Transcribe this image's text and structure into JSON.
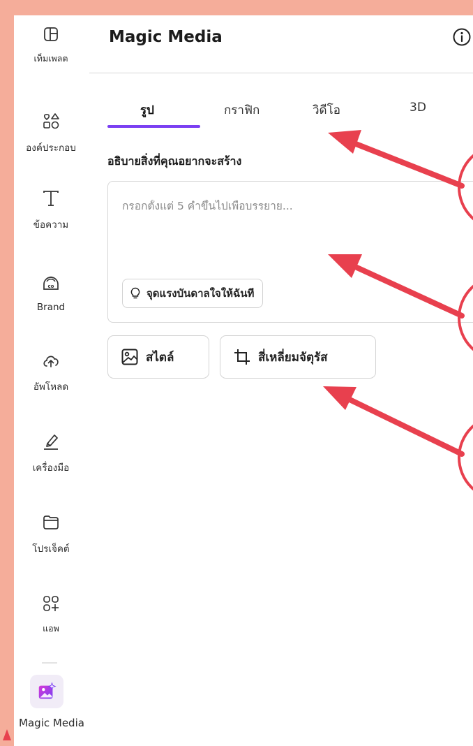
{
  "sidebar": {
    "items": [
      {
        "label": "เท็มเพลต",
        "icon": "template-icon"
      },
      {
        "label": "องค์ประกอบ",
        "icon": "elements-icon"
      },
      {
        "label": "ข้อความ",
        "icon": "text-icon"
      },
      {
        "label": "Brand",
        "icon": "brand-icon"
      },
      {
        "label": "อัพโหลด",
        "icon": "upload-cloud-icon"
      },
      {
        "label": "เครื่องมือ",
        "icon": "draw-tools-icon"
      },
      {
        "label": "โปรเจ็คต์",
        "icon": "folder-icon"
      },
      {
        "label": "แอพ",
        "icon": "apps-icon"
      }
    ],
    "magic_media": {
      "label": "Magic Media",
      "icon": "magic-media-icon"
    }
  },
  "header": {
    "title": "Magic Media",
    "info_icon": "info-icon"
  },
  "tabs": [
    {
      "label": "รูป",
      "active": true
    },
    {
      "label": "กราฟิก",
      "active": false
    },
    {
      "label": "วิดีโอ",
      "active": false
    },
    {
      "label": "3D",
      "active": false
    }
  ],
  "prompt": {
    "label": "อธิบายสิ่งที่คุณอยากจะสร้าง",
    "placeholder": "กรอกตั้งแต่ 5 คำขึ้นไปเพื่อบรรยาย...",
    "inspire_label": "จุดแรงบันดาลใจให้ฉันที",
    "inspire_icon": "lightbulb-icon"
  },
  "options": {
    "style_label": "สไตล์",
    "style_icon": "image-icon",
    "aspect_label": "สี่เหลี่ยมจัตุรัส",
    "aspect_icon": "crop-icon"
  },
  "colors": {
    "page_background": "#f5ad9a",
    "accent": "#7b3ff2",
    "annotation": "#e8404e"
  }
}
